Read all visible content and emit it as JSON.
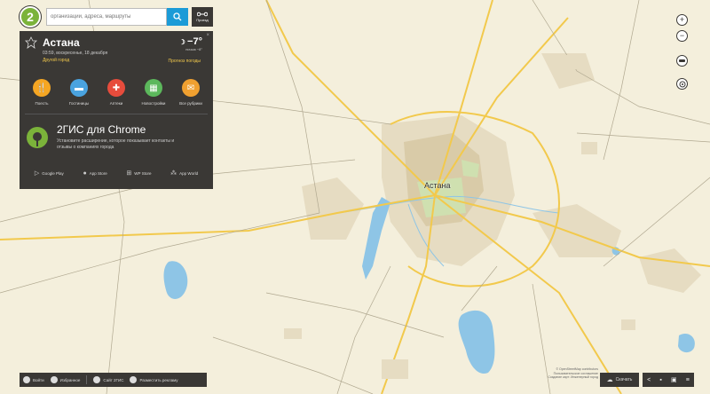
{
  "search": {
    "logo_text": "2",
    "placeholder": "организации, адреса, маршруты",
    "route_label": "Проезд"
  },
  "city": {
    "name": "Астана",
    "date_line": "03:59, воскресенье, 18 декабря",
    "other_city_link": "Другой город",
    "temperature": "−7°",
    "feels_like": "ночью −8°",
    "forecast_link": "Прогноз погоды"
  },
  "categories": [
    {
      "label": "Поесть",
      "color": "#f5a623",
      "icon": "fork-knife-icon",
      "glyph": "🍴"
    },
    {
      "label": "Гостиницы",
      "color": "#4aa3df",
      "icon": "bed-icon",
      "glyph": "🛏"
    },
    {
      "label": "Аптеки",
      "color": "#e74c3c",
      "icon": "cross-icon",
      "glyph": "✚"
    },
    {
      "label": "Новостройки",
      "color": "#5cb85c",
      "icon": "building-icon",
      "glyph": "▦"
    },
    {
      "label": "Все рубрики",
      "color": "#f0a030",
      "icon": "list-icon",
      "glyph": "✉"
    }
  ],
  "promo": {
    "title": "2ГИС для Chrome",
    "text": "Установите расширение, которое показывает контакты и отзывы о компаниях города"
  },
  "stores": [
    {
      "label": "Google Play",
      "icon": "play-icon",
      "glyph": "▷"
    },
    {
      "label": "App Store",
      "icon": "apple-icon",
      "glyph": ""
    },
    {
      "label": "WP Store",
      "icon": "windows-icon",
      "glyph": "⊞"
    },
    {
      "label": "App World",
      "icon": "blackberry-icon",
      "glyph": "⁂"
    }
  ],
  "map_labels": {
    "city": "Астана"
  },
  "bottom": {
    "login": "Войти",
    "favorites": "Избранное",
    "site": "Сайт 2ГИС",
    "ads": "Разместить рекламу",
    "download": "Скачать"
  },
  "copyright": {
    "line1": "© OpenStreetMap contributors",
    "line2": "Пользовательское соглашение",
    "line3": "Создание карт: Инженерный город"
  }
}
